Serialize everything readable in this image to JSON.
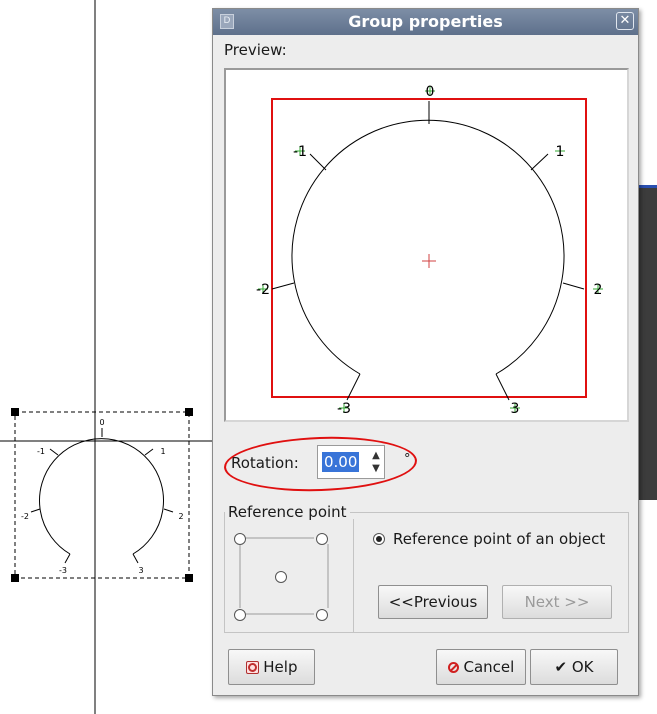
{
  "dialog": {
    "title": "Group properties",
    "close_symbol": "✕",
    "preview_label": "Preview:",
    "rotation_label": "Rotation:",
    "rotation_value": "0.00",
    "rotation_unit": "°",
    "reference_point_legend": "Reference point",
    "reference_object_option": "Reference point of an object",
    "previous_button": "<<Previous",
    "next_button": "Next >>",
    "help_button": "Help",
    "cancel_button": "Cancel",
    "ok_button": "OK"
  },
  "preview_scale_labels": [
    "0",
    "1",
    "2",
    "3",
    "-3",
    "-2",
    "-1"
  ],
  "background_scale_labels": [
    "0",
    "1",
    "2",
    "3",
    "-3",
    "-2",
    "-1"
  ],
  "colors": {
    "bounding_box": "#e01010",
    "label_marker": "#33aa33",
    "selection_accent": "#3874d8",
    "annotation_oval": "#e01010"
  }
}
